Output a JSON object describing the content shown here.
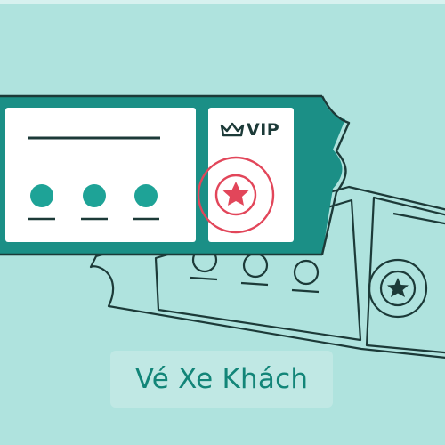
{
  "ticket": {
    "badge_label": "VIP",
    "badge_icon": "crown-icon",
    "stamp_icon": "star-icon",
    "dots": 3
  },
  "caption": {
    "text": "Vé Xe Khách"
  },
  "colors": {
    "background": "#afe3de",
    "ticket_border": "#1b8f86",
    "ticket_fill": "#ffffff",
    "dots": "#1ea397",
    "stamp": "#e2465a",
    "outline": "#1c3a38",
    "caption_box": "#c0e8e4",
    "caption_text": "#128578"
  }
}
